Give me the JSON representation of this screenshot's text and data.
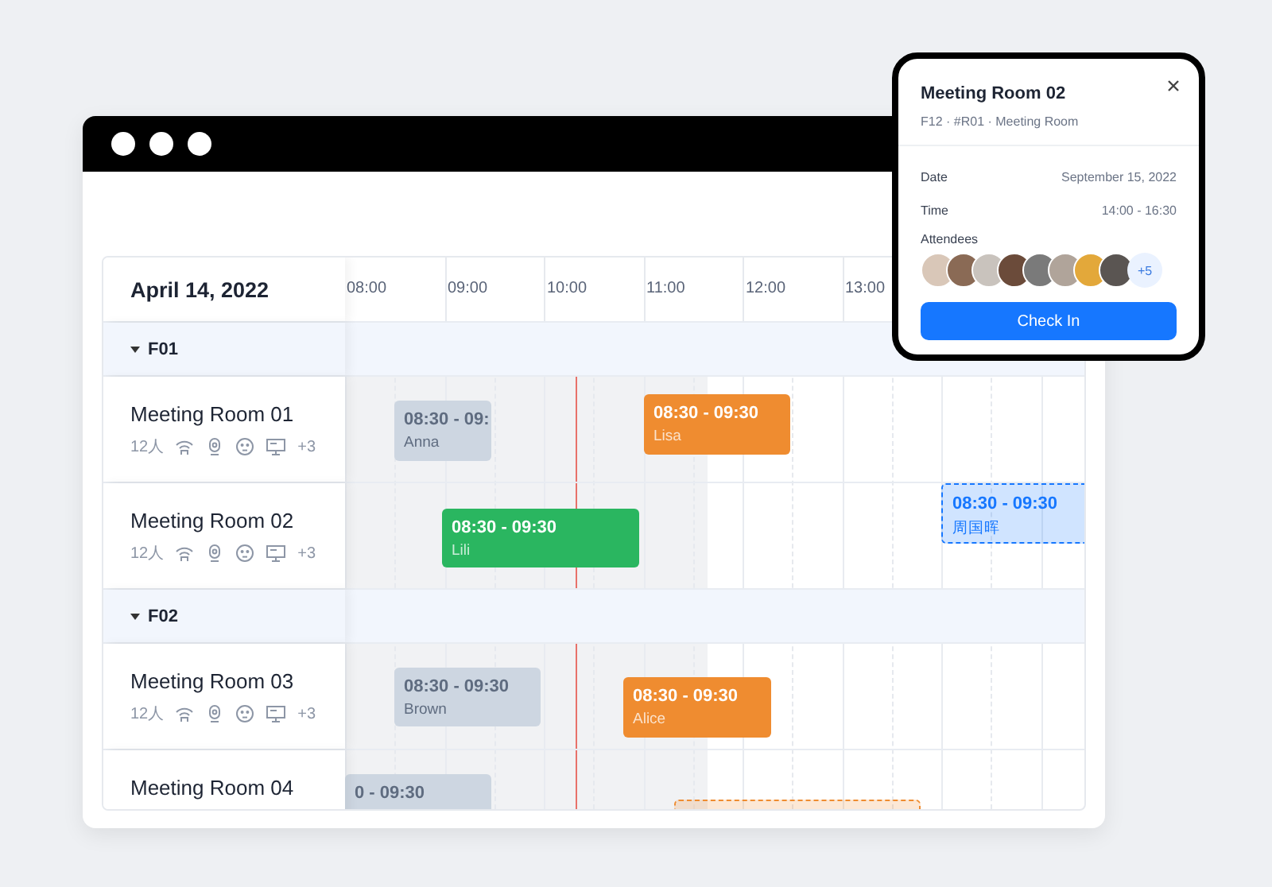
{
  "calendar": {
    "date": "April 14, 2022",
    "hours": [
      "08:00",
      "09:00",
      "10:00",
      "11:00",
      "12:00",
      "13:00"
    ],
    "groups": [
      {
        "label": "F01",
        "expanded": true,
        "rooms": [
          {
            "name": "Meeting Room 01",
            "capacity": "12人",
            "more": "+3",
            "events": [
              {
                "kind": "past",
                "time": "08:30 - 09:",
                "person": "Anna"
              },
              {
                "kind": "booked",
                "color": "#ef8c30",
                "time": "08:30 - 09:30",
                "person": "Lisa"
              }
            ]
          },
          {
            "name": "Meeting Room 02",
            "capacity": "12人",
            "more": "+3",
            "events": [
              {
                "kind": "booked",
                "color": "#2ab660",
                "time": "08:30 - 09:30",
                "person": "Lili"
              },
              {
                "kind": "tentative",
                "color": "#1677ff",
                "time": "08:30 - 09:30",
                "person": "周国晖"
              }
            ]
          }
        ]
      },
      {
        "label": "F02",
        "expanded": true,
        "rooms": [
          {
            "name": "Meeting Room 03",
            "capacity": "12人",
            "more": "+3",
            "events": [
              {
                "kind": "past",
                "time": "08:30 - 09:30",
                "person": "Brown"
              },
              {
                "kind": "booked",
                "color": "#ef8c30",
                "time": "08:30 - 09:30",
                "person": "Alice"
              }
            ]
          },
          {
            "name": "Meeting Room 04",
            "events": [
              {
                "kind": "past",
                "time": "0 - 09:30"
              },
              {
                "kind": "tentative",
                "color": "#ef8c30"
              }
            ]
          }
        ]
      }
    ]
  },
  "popover": {
    "title": "Meeting Room 02",
    "subtitle": "F12 · #R01 · Meeting Room",
    "details": [
      {
        "label": "Date",
        "value": "September 15, 2022"
      },
      {
        "label": "Time",
        "value": "14:00 - 16:30"
      }
    ],
    "attendees_label": "Attendees",
    "attendees_more": "+5",
    "button": "Check In"
  }
}
